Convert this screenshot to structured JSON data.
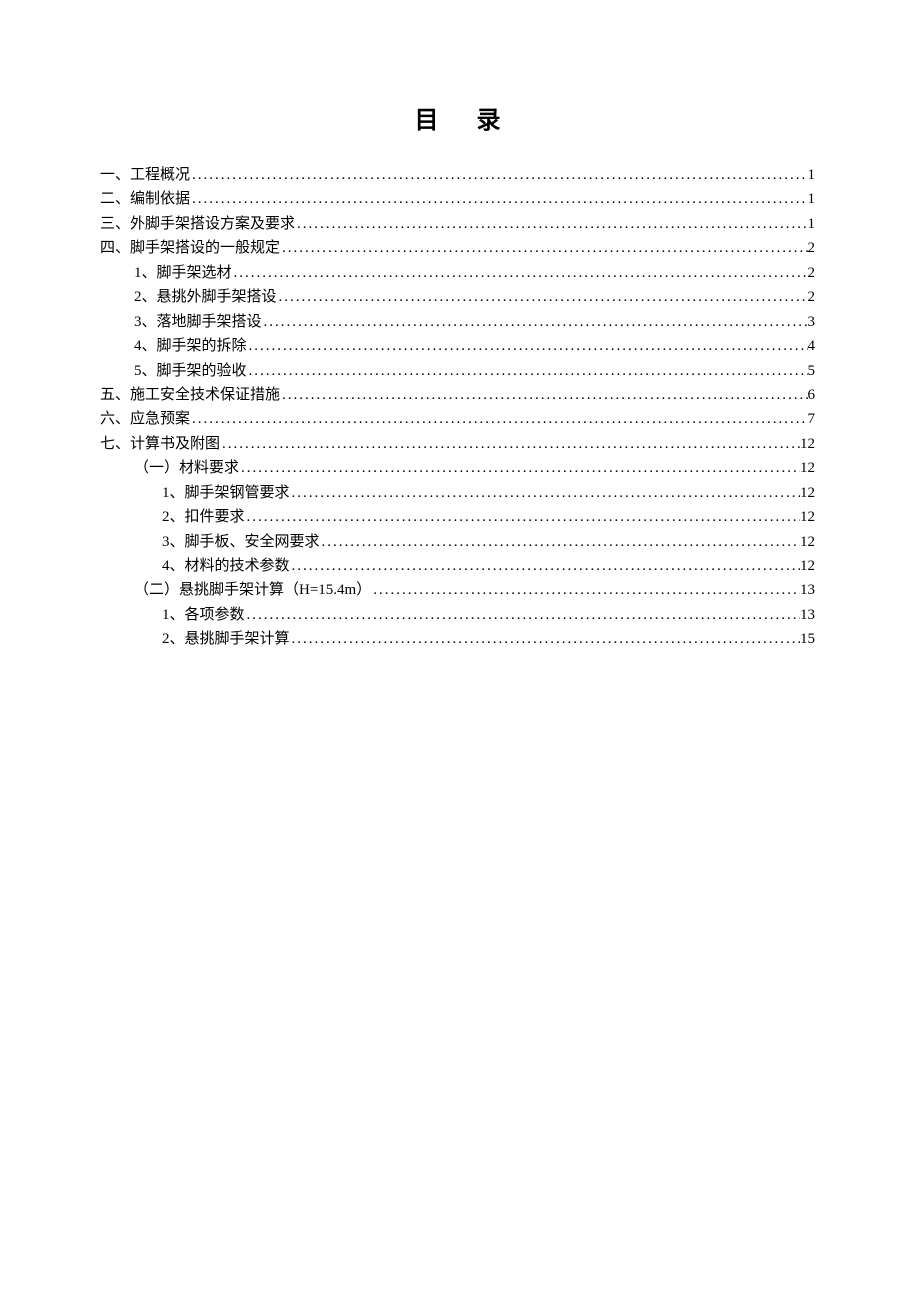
{
  "title": "目录",
  "entries": [
    {
      "label": "一、工程概况",
      "page": "1",
      "indent": 1
    },
    {
      "label": "二、编制依据",
      "page": "1",
      "indent": 1
    },
    {
      "label": "三、外脚手架搭设方案及要求",
      "page": "1",
      "indent": 1
    },
    {
      "label": "四、脚手架搭设的一般规定",
      "page": "2",
      "indent": 1
    },
    {
      "label": "1、脚手架选材",
      "page": "2",
      "indent": 2
    },
    {
      "label": "2、悬挑外脚手架搭设",
      "page": "2",
      "indent": 2
    },
    {
      "label": "3、落地脚手架搭设",
      "page": "3",
      "indent": 2
    },
    {
      "label": "4、脚手架的拆除",
      "page": "4",
      "indent": 2
    },
    {
      "label": "5、脚手架的验收",
      "page": "5",
      "indent": 2
    },
    {
      "label": "五、施工安全技术保证措施",
      "page": "6",
      "indent": 1
    },
    {
      "label": "六、应急预案",
      "page": "7",
      "indent": 1
    },
    {
      "label": "七、计算书及附图",
      "page": "12",
      "indent": 1
    },
    {
      "label": "（一）材料要求",
      "page": "12",
      "indent": 3
    },
    {
      "label": "1、脚手架钢管要求",
      "page": "12",
      "indent": 4
    },
    {
      "label": "2、扣件要求",
      "page": "12",
      "indent": 4
    },
    {
      "label": "3、脚手板、安全网要求",
      "page": "12",
      "indent": 4
    },
    {
      "label": "4、材料的技术参数",
      "page": "12",
      "indent": 4
    },
    {
      "label": "（二）悬挑脚手架计算（H=15.4m）",
      "page": "13",
      "indent": 3
    },
    {
      "label": "1、各项参数",
      "page": "13",
      "indent": 4
    },
    {
      "label": "2、悬挑脚手架计算",
      "page": "15",
      "indent": 4
    }
  ]
}
